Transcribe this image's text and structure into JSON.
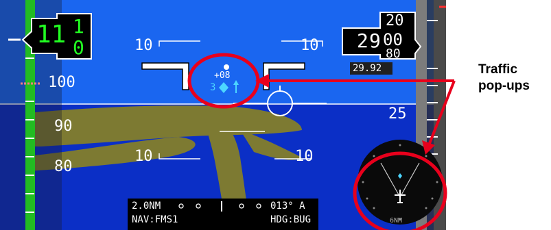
{
  "pfd": {
    "speed_tape": {
      "current": "11",
      "drum_top": "1",
      "drum_bottom": "0",
      "ticks": [
        "100",
        "90",
        "80"
      ]
    },
    "pitch_ladder": {
      "upper_left": "10",
      "upper_right": "10",
      "lower_left": "10",
      "lower_right": "10"
    },
    "altitude": {
      "thousands": "2",
      "hundreds": "9",
      "drum_tens": "00",
      "drum_above": "20",
      "drum_below": "80",
      "tick_25": "25"
    },
    "baro_setting": "29.92",
    "traffic": {
      "relative_altitude": "+08",
      "range": "3"
    },
    "nav_box": {
      "range": "2.0NM",
      "bearing": "013° A",
      "source": "NAV:FMS1",
      "heading_mode": "HDG:BUG"
    },
    "inset_map": {
      "range_label": "6NM"
    }
  },
  "callout": {
    "line1": "Traffic",
    "line2": "pop-ups"
  },
  "colors": {
    "sky": "#1a66f0",
    "ground": "#0b2fc6",
    "terrain": "#7d7a32",
    "speed_band": "#22bb22",
    "callout_red": "#e8001c"
  }
}
